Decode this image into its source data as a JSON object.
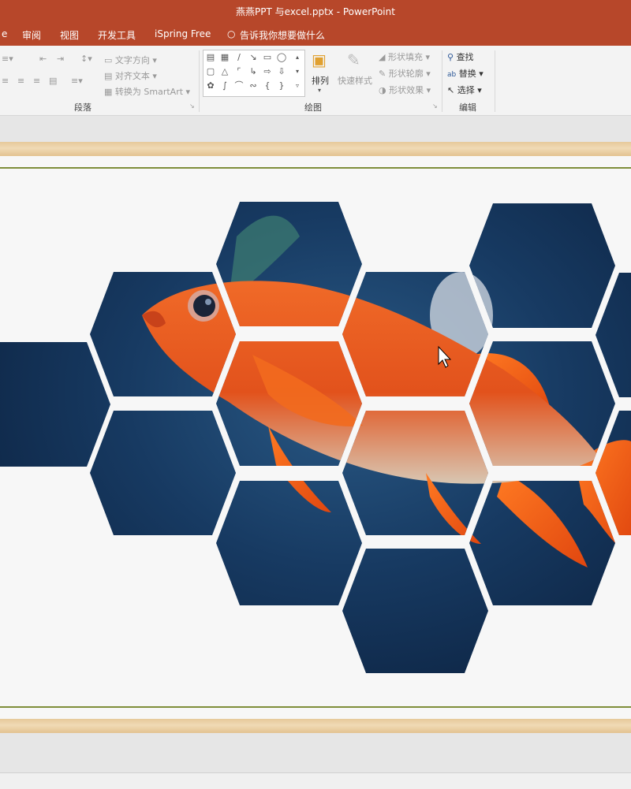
{
  "window": {
    "title": "燕燕PPT 与excel.pptx  -  PowerPoint"
  },
  "menu": {
    "review": "审阅",
    "view": "视图",
    "developer": "开发工具",
    "ispring": "iSpring Free",
    "tellme": "告诉我你想要做什么"
  },
  "ribbon": {
    "paragraph": {
      "text_direction": "文字方向",
      "align_text": "对齐文本",
      "convert_smartart": "转换为 SmartArt",
      "group_label": "段落"
    },
    "drawing": {
      "arrange": "排列",
      "quick_styles": "快速样式",
      "shape_fill": "形状填充",
      "shape_outline": "形状轮廓",
      "shape_effects": "形状效果",
      "group_label": "绘图"
    },
    "editing": {
      "find": "查找",
      "replace": "替换",
      "select": "选择",
      "group_label": "编辑"
    }
  },
  "colors": {
    "accent": "#b7472a",
    "slide_line": "#7f8e3a",
    "fish": "#e8551e",
    "water": "#143255"
  },
  "slide": {
    "image": "orange fish behind hexagon mosaic"
  }
}
